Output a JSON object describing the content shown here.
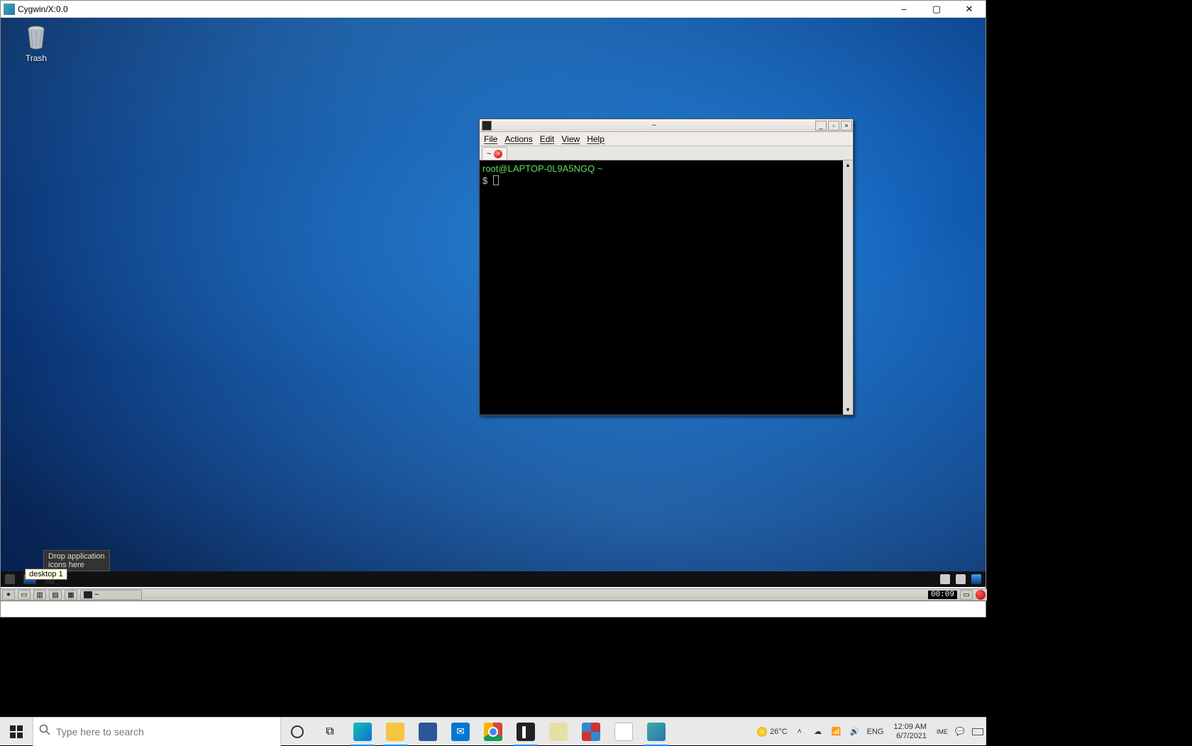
{
  "outer_window": {
    "title": "Cygwin/X:0.0",
    "controls": {
      "min": "–",
      "max": "▢",
      "close": "✕"
    }
  },
  "desktop": {
    "trash_label": "Trash",
    "tooltip": "desktop 1",
    "appdrop_text": "Drop application\nicons here"
  },
  "terminal": {
    "title": "~",
    "menus": {
      "file": "File",
      "actions": "Actions",
      "edit": "Edit",
      "view": "View",
      "help": "Help"
    },
    "tab_label": "~",
    "prompt_userhost": "root@LAPTOP-0L9A5NGQ ~",
    "prompt_symbol": "$",
    "controls": {
      "min": "_",
      "max": "▫",
      "close": "×"
    }
  },
  "xpanel_top": {
    "task_label": "~",
    "tray": {}
  },
  "xpanel2": {
    "task_label": "~",
    "clock": "00:09"
  },
  "win_taskbar": {
    "search_placeholder": "Type here to search",
    "temperature": "26°C",
    "lang": "ENG",
    "ime": "IME",
    "time": "12:09 AM",
    "date": "6/7/2021"
  }
}
